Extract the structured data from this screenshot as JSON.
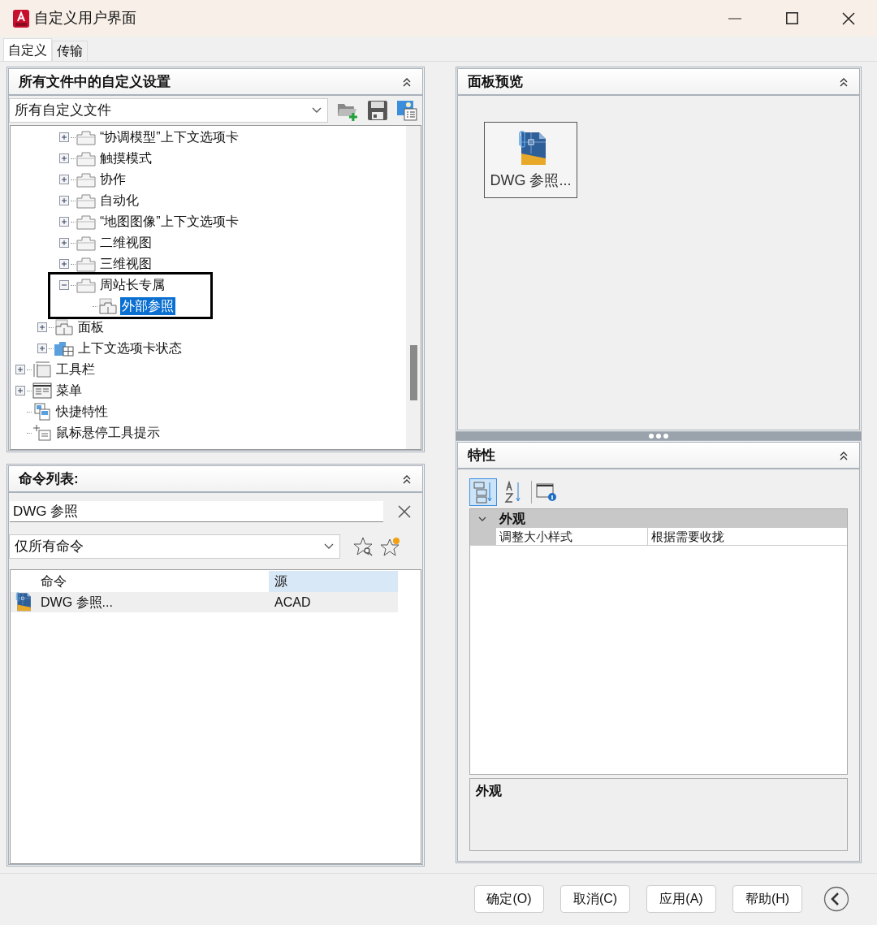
{
  "window": {
    "title": "自定义用户界面"
  },
  "tabs": [
    {
      "label": "自定义",
      "selected": true
    },
    {
      "label": "传输",
      "selected": false
    }
  ],
  "customizations": {
    "title": "所有文件中的自定义设置",
    "file_filter": "所有自定义文件",
    "tree": [
      {
        "children": [
          {
            "children": [
              {
                "label": "“协调模型”上下文选项卡",
                "kind": "tab",
                "expanded": false,
                "selected": false
              },
              {
                "label": "触摸模式",
                "kind": "tab",
                "expanded": false,
                "selected": false
              },
              {
                "label": "协作",
                "kind": "tab",
                "expanded": false,
                "selected": false
              },
              {
                "label": "自动化",
                "kind": "tab",
                "expanded": false,
                "selected": false
              },
              {
                "label": "“地图图像”上下文选项卡",
                "kind": "tab",
                "expanded": false,
                "selected": false
              },
              {
                "label": "二维视图",
                "kind": "tab",
                "expanded": false,
                "selected": false
              },
              {
                "label": "三维视图",
                "kind": "tab",
                "expanded": false,
                "selected": false
              },
              {
                "label": "周站长专属",
                "kind": "tab",
                "expanded": true,
                "selected": false,
                "framed": true,
                "children": [
                  {
                    "label": "外部参照",
                    "kind": "panel",
                    "selected": true
                  }
                ]
              }
            ]
          },
          {
            "label": "面板",
            "kind": "panel",
            "expanded": false,
            "selected": false
          },
          {
            "label": "上下文选项卡状态",
            "kind": "contextual",
            "expanded": false,
            "selected": false
          }
        ]
      },
      {
        "label": "工具栏",
        "kind": "toolbar",
        "expanded": false,
        "selected": false
      },
      {
        "label": "菜单",
        "kind": "menu",
        "expanded": false,
        "selected": false
      },
      {
        "label": "快捷特性",
        "kind": "quickprops",
        "selected": false
      },
      {
        "label": "鼠标悬停工具提示",
        "kind": "rollover",
        "selected": false
      }
    ]
  },
  "command_list": {
    "title": "命令列表:",
    "search": "DWG 参照",
    "filter": "仅所有命令",
    "columns": [
      {
        "label": "命令",
        "sorted": false
      },
      {
        "label": "源",
        "sorted": true
      }
    ],
    "rows": [
      {
        "command": "DWG 参照...",
        "source": "ACAD",
        "selected": true
      }
    ]
  },
  "panel_preview": {
    "title": "面板预览",
    "buttons": [
      {
        "label": "DWG 参照..."
      }
    ]
  },
  "properties": {
    "title": "特性",
    "view_modes": [
      {
        "kind": "categorized",
        "selected": true
      },
      {
        "kind": "alphabetical",
        "selected": false
      }
    ],
    "categories": [
      {
        "label": "外观",
        "expanded": true,
        "rows": [
          {
            "name": "调整大小样式",
            "value": "根据需要收拢"
          }
        ]
      }
    ],
    "description": {
      "title": "外观"
    }
  },
  "buttons": [
    {
      "label": "确定(O)"
    },
    {
      "label": "取消(C)"
    },
    {
      "label": "应用(A)"
    },
    {
      "label": "帮助(H)"
    }
  ]
}
